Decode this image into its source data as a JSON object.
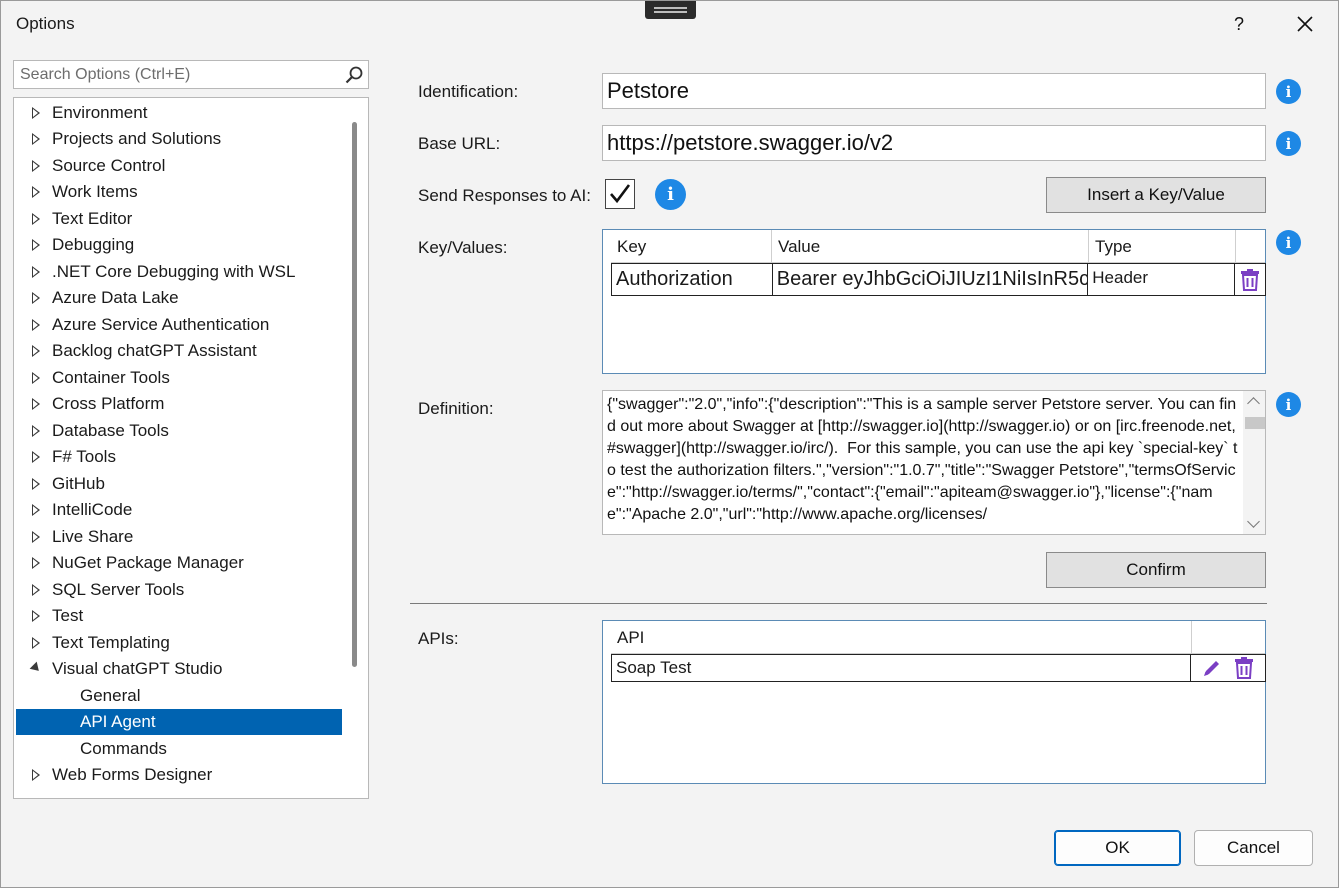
{
  "window": {
    "title": "Options",
    "help_label": "?",
    "close_label": "✕"
  },
  "search": {
    "placeholder": "Search Options (Ctrl+E)"
  },
  "tree": {
    "items": [
      {
        "label": "Environment"
      },
      {
        "label": "Projects and Solutions"
      },
      {
        "label": "Source Control"
      },
      {
        "label": "Work Items"
      },
      {
        "label": "Text Editor"
      },
      {
        "label": "Debugging"
      },
      {
        "label": ".NET Core Debugging with WSL"
      },
      {
        "label": "Azure Data Lake"
      },
      {
        "label": "Azure Service Authentication"
      },
      {
        "label": "Backlog chatGPT Assistant"
      },
      {
        "label": "Container Tools"
      },
      {
        "label": "Cross Platform"
      },
      {
        "label": "Database Tools"
      },
      {
        "label": "F# Tools"
      },
      {
        "label": "GitHub"
      },
      {
        "label": "IntelliCode"
      },
      {
        "label": "Live Share"
      },
      {
        "label": "NuGet Package Manager"
      },
      {
        "label": "SQL Server Tools"
      },
      {
        "label": "Test"
      },
      {
        "label": "Text Templating"
      },
      {
        "label": "Visual chatGPT Studio"
      },
      {
        "label": "General"
      },
      {
        "label": "API Agent"
      },
      {
        "label": "Commands"
      },
      {
        "label": "Web Forms Designer"
      }
    ]
  },
  "form": {
    "identification_label": "Identification:",
    "identification_value": "Petstore",
    "base_url_label": "Base URL:",
    "base_url_value": "https://petstore.swagger.io/v2",
    "send_responses_label": "Send Responses to AI:",
    "insert_button": "Insert a Key/Value",
    "key_values_label": "Key/Values:",
    "kv_headers": {
      "key": "Key",
      "value": "Value",
      "type": "Type"
    },
    "kv_rows": [
      {
        "key": "Authorization",
        "value": "Bearer eyJhbGciOiJIUzI1NiIsInR5c(",
        "type": "Header"
      }
    ],
    "definition_label": "Definition:",
    "definition_text": "{\"swagger\":\"2.0\",\"info\":{\"description\":\"This is a sample server Petstore server. You can find out more about Swagger at [http://swagger.io](http://swagger.io) or on [irc.freenode.net, #swagger](http://swagger.io/irc/).  For this sample, you can use the api key `special-key` to test the authorization filters.\",\"version\":\"1.0.7\",\"title\":\"Swagger Petstore\",\"termsOfService\":\"http://swagger.io/terms/\",\"contact\":{\"email\":\"apiteam@swagger.io\"},\"license\":{\"name\":\"Apache 2.0\",\"url\":\"http://www.apache.org/licenses/",
    "confirm_button": "Confirm",
    "apis_label": "APIs:",
    "apis_header": "API",
    "apis_rows": [
      {
        "name": "Soap Test"
      }
    ]
  },
  "footer": {
    "ok": "OK",
    "cancel": "Cancel"
  },
  "colors": {
    "selection": "#0063b1",
    "info": "#1e88e5",
    "action_icon": "#7b3fc4"
  }
}
